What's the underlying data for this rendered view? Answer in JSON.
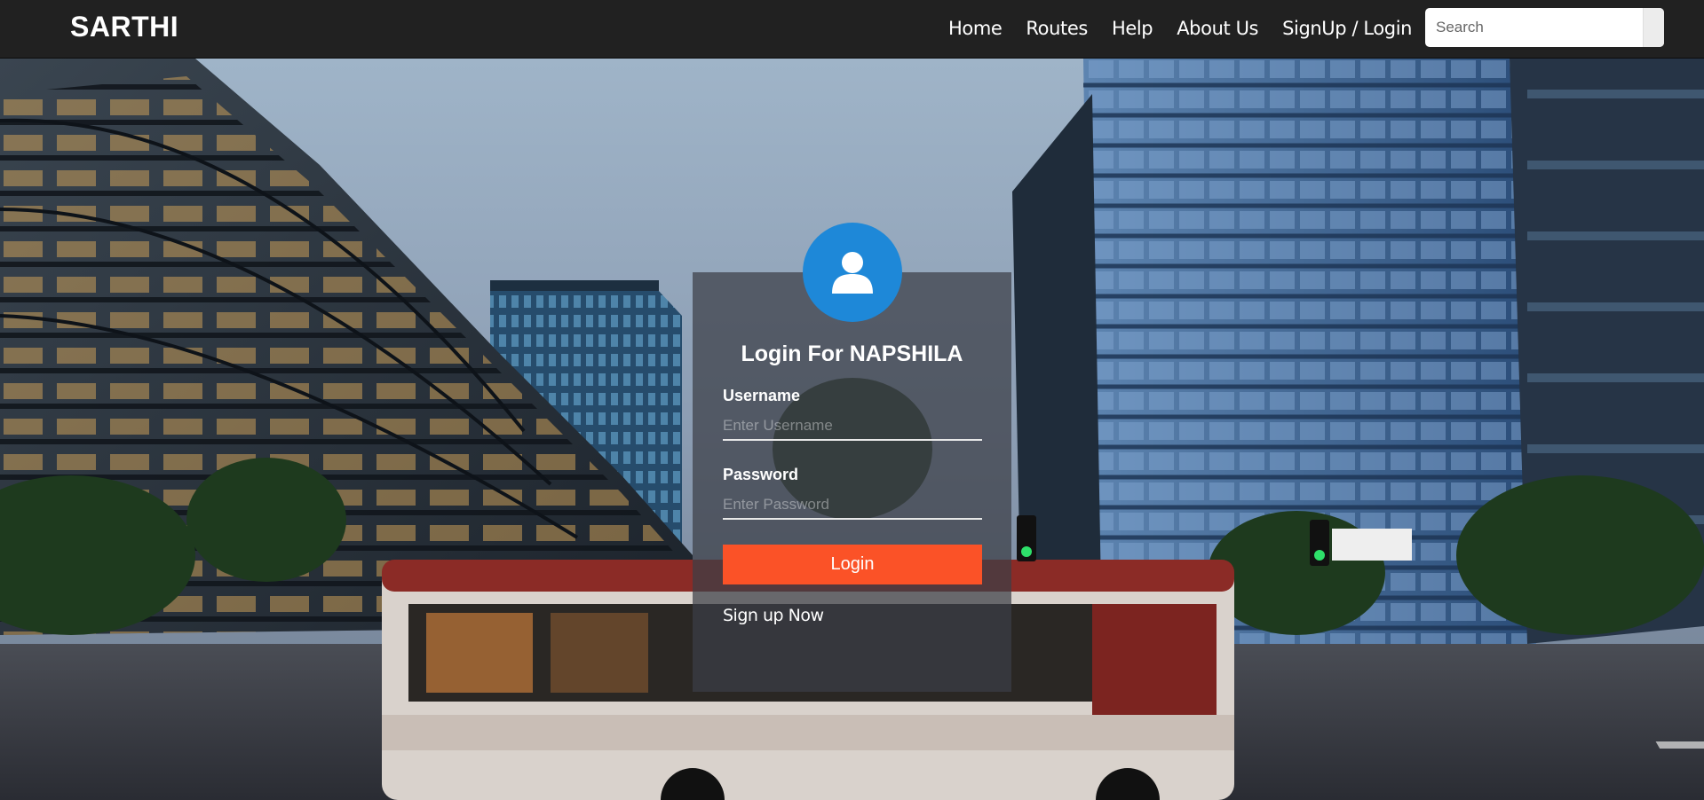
{
  "navbar": {
    "brand": "SARTHI",
    "links": [
      {
        "label": "Home"
      },
      {
        "label": "Routes"
      },
      {
        "label": "Help"
      },
      {
        "label": "About Us"
      },
      {
        "label": "SignUp / Login"
      }
    ],
    "search": {
      "placeholder": "Search",
      "value": ""
    }
  },
  "login": {
    "icon": "user-icon",
    "title": "Login For NAPSHILA",
    "username_label": "Username",
    "username_placeholder": "Enter Username",
    "password_label": "Password",
    "password_placeholder": "Enter Password",
    "button_label": "Login",
    "signup_link": "Sign up Now"
  },
  "colors": {
    "navbar_bg": "#212121",
    "avatar_bg": "#1e88d8",
    "login_button": "#fb5227"
  }
}
